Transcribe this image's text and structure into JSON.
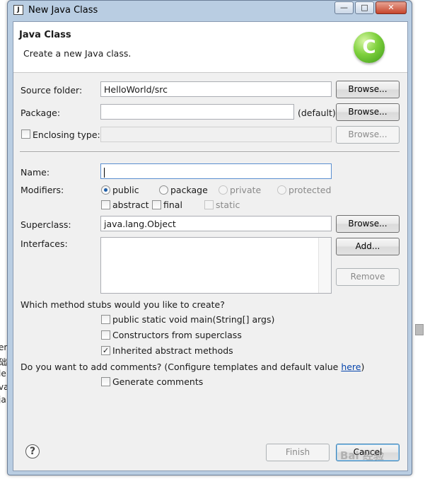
{
  "background": {
    "left_fragments": [
      "em",
      "础",
      "le",
      "va",
      "ja"
    ]
  },
  "window": {
    "title": "New Java Class",
    "minimize": "—",
    "maximize": "□",
    "close": "✕"
  },
  "banner": {
    "title": "Java Class",
    "description": "Create a new Java class.",
    "logo_letter": "C",
    "logo_color": "#5bb52a"
  },
  "source_folder": {
    "label": "Source folder:",
    "value": "HelloWorld/src",
    "browse": "Browse..."
  },
  "package": {
    "label": "Package:",
    "value": "",
    "default_hint": "(default)",
    "browse": "Browse..."
  },
  "enclosing_type": {
    "label": "Enclosing type:",
    "checked": false,
    "value": "",
    "browse": "Browse..."
  },
  "name": {
    "label": "Name:",
    "value": ""
  },
  "modifiers": {
    "label": "Modifiers:",
    "access": [
      {
        "label": "public",
        "selected": true,
        "enabled": true
      },
      {
        "label": "package",
        "selected": false,
        "enabled": true
      },
      {
        "label": "private",
        "selected": false,
        "enabled": false
      },
      {
        "label": "protected",
        "selected": false,
        "enabled": false
      }
    ],
    "flags": [
      {
        "label": "abstract",
        "checked": false,
        "enabled": true
      },
      {
        "label": "final",
        "checked": false,
        "enabled": true
      },
      {
        "label": "static",
        "checked": false,
        "enabled": false
      }
    ]
  },
  "superclass": {
    "label": "Superclass:",
    "value": "java.lang.Object",
    "browse": "Browse..."
  },
  "interfaces": {
    "label": "Interfaces:",
    "add": "Add...",
    "remove": "Remove"
  },
  "stubs": {
    "question": "Which method stubs would you like to create?",
    "options": [
      {
        "label": "public static void main(String[] args)",
        "checked": false
      },
      {
        "label": "Constructors from superclass",
        "checked": false
      },
      {
        "label": "Inherited abstract methods",
        "checked": true
      }
    ]
  },
  "comments": {
    "question_prefix": "Do you want to add comments? (Configure templates and default value ",
    "link": "here",
    "question_suffix": ")",
    "generate_label": "Generate comments",
    "checked": false
  },
  "footer": {
    "help": "?",
    "finish": "Finish",
    "cancel": "Cancel"
  },
  "watermark": "Bai 经验"
}
